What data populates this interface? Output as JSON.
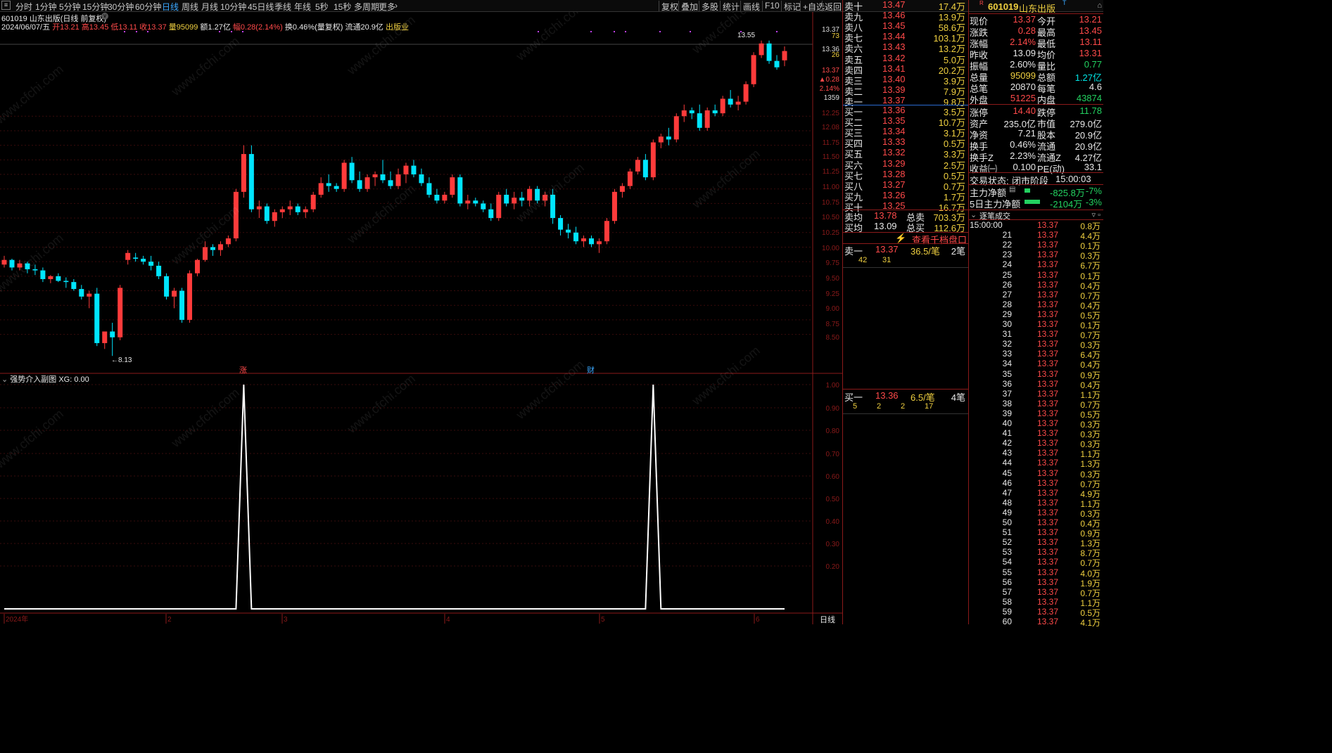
{
  "toolbar": {
    "periods": [
      "分时",
      "1分钟",
      "5分钟",
      "15分钟",
      "30分钟",
      "60分钟",
      "日线",
      "周线",
      "月线",
      "10分钟",
      "45日线",
      "季线",
      "年线",
      "5秒",
      "15秒",
      "多周期",
      "更多"
    ],
    "active_period": "日线",
    "right_buttons": [
      "复权",
      "叠加",
      "多股",
      "统计",
      "画线",
      "F10",
      "标记",
      "+自选",
      "返回"
    ]
  },
  "main_chart": {
    "title": "601019 山东出版(日线 前复权)",
    "date": "2024/06/07/五",
    "open": "开13.21",
    "high": "高13.45",
    "low": "低13.11",
    "close": "收13.37",
    "volume": "量95099",
    "amount": "额1.27亿",
    "change": "幅0.28(2.14%)",
    "turnover": "换0.46%(量复权)",
    "float": "流通20.9亿",
    "sector": "出版业",
    "high_label": "13.55",
    "low_label": "8.13",
    "marker_zhang": "涨",
    "marker_cai": "财",
    "price_axis": [
      "13.37",
      "13.36",
      "12.25",
      "12.08",
      "11.75",
      "11.50",
      "11.25",
      "11.00",
      "10.75",
      "10.50",
      "10.25",
      "10.00",
      "9.75",
      "9.50",
      "9.25",
      "9.00",
      "8.75",
      "8.50"
    ],
    "price_axis_side": [
      "73",
      "26",
      "13.37",
      "▲0.28",
      "2.14%",
      "1359"
    ],
    "candles_ohlc_note": "daily candles Jan–Jun 2024",
    "candles": [
      [
        9.7,
        9.85,
        9.65,
        9.78
      ],
      [
        9.78,
        9.8,
        9.6,
        9.65
      ],
      [
        9.65,
        9.78,
        9.6,
        9.72
      ],
      [
        9.72,
        9.75,
        9.55,
        9.62
      ],
      [
        9.62,
        9.7,
        9.52,
        9.6
      ],
      [
        9.6,
        9.65,
        9.4,
        9.45
      ],
      [
        9.45,
        9.52,
        9.38,
        9.5
      ],
      [
        9.5,
        9.55,
        9.4,
        9.42
      ],
      [
        9.42,
        9.48,
        9.3,
        9.4
      ],
      [
        9.4,
        9.45,
        9.25,
        9.28
      ],
      [
        9.28,
        9.35,
        9.1,
        9.15
      ],
      [
        9.15,
        9.25,
        8.95,
        9.2
      ],
      [
        9.2,
        9.3,
        8.3,
        8.35
      ],
      [
        8.35,
        8.55,
        8.25,
        8.55
      ],
      [
        8.55,
        8.7,
        8.13,
        8.45
      ],
      [
        8.45,
        9.35,
        8.4,
        9.3
      ],
      [
        9.78,
        9.95,
        9.7,
        9.9
      ],
      [
        9.82,
        9.9,
        9.75,
        9.8
      ],
      [
        9.8,
        9.85,
        9.7,
        9.75
      ],
      [
        9.75,
        9.85,
        9.6,
        9.68
      ],
      [
        9.68,
        9.75,
        9.45,
        9.5
      ],
      [
        9.5,
        9.55,
        9.1,
        9.15
      ],
      [
        9.15,
        9.3,
        8.95,
        9.25
      ],
      [
        9.25,
        9.3,
        8.7,
        8.75
      ],
      [
        8.75,
        9.6,
        8.7,
        9.55
      ],
      [
        9.55,
        9.8,
        9.5,
        9.78
      ],
      [
        9.78,
        10.1,
        9.75,
        10.0
      ],
      [
        10.0,
        10.05,
        9.85,
        9.95
      ],
      [
        9.95,
        10.1,
        9.85,
        10.05
      ],
      [
        10.05,
        10.2,
        10.0,
        10.15
      ],
      [
        10.15,
        11.0,
        10.1,
        10.95
      ],
      [
        10.95,
        11.75,
        10.85,
        11.6
      ],
      [
        11.6,
        11.75,
        10.6,
        10.65
      ],
      [
        10.65,
        10.8,
        10.5,
        10.7
      ],
      [
        10.7,
        10.75,
        10.4,
        10.45
      ],
      [
        10.45,
        10.65,
        10.35,
        10.6
      ],
      [
        10.6,
        10.7,
        10.5,
        10.65
      ],
      [
        10.65,
        10.8,
        10.55,
        10.7
      ],
      [
        10.7,
        10.75,
        10.55,
        10.6
      ],
      [
        10.6,
        10.7,
        10.5,
        10.65
      ],
      [
        10.65,
        10.95,
        10.6,
        10.9
      ],
      [
        10.9,
        11.2,
        10.85,
        11.1
      ],
      [
        11.1,
        11.25,
        10.95,
        11.05
      ],
      [
        11.05,
        11.1,
        10.95,
        11.0
      ],
      [
        11.0,
        11.5,
        10.95,
        11.45
      ],
      [
        11.45,
        11.55,
        11.1,
        11.15
      ],
      [
        11.15,
        11.3,
        10.95,
        11.0
      ],
      [
        11.0,
        11.25,
        10.95,
        11.2
      ],
      [
        11.2,
        11.3,
        11.05,
        11.25
      ],
      [
        11.25,
        11.5,
        11.1,
        11.15
      ],
      [
        11.15,
        11.3,
        11.0,
        11.05
      ],
      [
        11.05,
        11.35,
        11.0,
        11.25
      ],
      [
        11.25,
        11.45,
        11.1,
        11.4
      ],
      [
        11.4,
        11.5,
        11.2,
        11.25
      ],
      [
        11.25,
        11.35,
        11.05,
        11.1
      ],
      [
        11.1,
        11.2,
        10.85,
        10.9
      ],
      [
        10.9,
        11.0,
        10.75,
        10.8
      ],
      [
        10.8,
        10.95,
        10.75,
        10.9
      ],
      [
        10.9,
        11.25,
        10.85,
        11.2
      ],
      [
        11.2,
        11.25,
        10.7,
        10.75
      ],
      [
        10.75,
        10.9,
        10.65,
        10.8
      ],
      [
        10.8,
        10.85,
        10.7,
        10.75
      ],
      [
        10.75,
        10.8,
        10.6,
        10.65
      ],
      [
        10.65,
        10.75,
        10.45,
        10.5
      ],
      [
        10.5,
        10.95,
        10.45,
        10.9
      ],
      [
        10.9,
        11.0,
        10.7,
        10.75
      ],
      [
        10.75,
        10.95,
        10.65,
        10.85
      ],
      [
        10.85,
        10.95,
        10.7,
        10.8
      ],
      [
        10.8,
        11.05,
        10.7,
        11.0
      ],
      [
        11.0,
        11.05,
        10.75,
        10.8
      ],
      [
        10.8,
        10.95,
        10.7,
        10.9
      ],
      [
        10.9,
        11.0,
        10.4,
        10.5
      ],
      [
        10.5,
        10.55,
        10.2,
        10.3
      ],
      [
        10.3,
        10.4,
        10.15,
        10.25
      ],
      [
        10.25,
        10.35,
        10.05,
        10.1
      ],
      [
        10.1,
        10.2,
        10.0,
        10.15
      ],
      [
        10.15,
        10.2,
        10.0,
        10.05
      ],
      [
        10.05,
        10.15,
        9.9,
        10.1
      ],
      [
        10.1,
        10.5,
        10.05,
        10.45
      ],
      [
        10.45,
        11.0,
        10.4,
        10.95
      ],
      [
        10.95,
        11.1,
        10.85,
        11.05
      ],
      [
        11.05,
        11.35,
        11.0,
        11.3
      ],
      [
        11.3,
        11.55,
        11.25,
        11.5
      ],
      [
        11.5,
        11.6,
        11.15,
        11.2
      ],
      [
        11.2,
        11.85,
        11.15,
        11.8
      ],
      [
        11.8,
        11.95,
        11.7,
        11.9
      ],
      [
        11.9,
        12.05,
        11.75,
        11.85
      ],
      [
        11.85,
        12.3,
        11.8,
        12.25
      ],
      [
        12.25,
        12.45,
        12.15,
        12.35
      ],
      [
        12.35,
        12.4,
        12.2,
        12.3
      ],
      [
        12.3,
        12.45,
        12.0,
        12.05
      ],
      [
        12.05,
        12.4,
        12.0,
        12.35
      ],
      [
        12.35,
        12.45,
        12.25,
        12.3
      ],
      [
        12.3,
        12.6,
        12.25,
        12.55
      ],
      [
        12.55,
        12.7,
        12.4,
        12.45
      ],
      [
        12.45,
        12.6,
        12.35,
        12.5
      ],
      [
        12.5,
        12.85,
        12.45,
        12.8
      ],
      [
        12.8,
        13.35,
        12.75,
        13.3
      ],
      [
        13.3,
        13.55,
        13.25,
        13.5
      ],
      [
        13.5,
        13.55,
        13.15,
        13.2
      ],
      [
        13.2,
        13.3,
        13.05,
        13.09
      ],
      [
        13.21,
        13.45,
        13.11,
        13.37
      ]
    ],
    "x_axis": [
      "2024年",
      "2",
      "3",
      "4",
      "5",
      "6"
    ],
    "period_label": "日线"
  },
  "sub_chart": {
    "title": "强势介入副图",
    "value": "XG: 0.00",
    "y_axis": [
      "1.00",
      "0.90",
      "0.80",
      "0.70",
      "0.60",
      "0.50",
      "0.40",
      "0.30",
      "0.20"
    ],
    "signals": [
      0,
      0,
      0,
      0,
      0,
      0,
      0,
      0,
      0,
      0,
      0,
      0,
      0,
      0,
      0,
      0,
      0,
      0,
      0,
      0,
      0,
      0,
      0,
      0,
      0,
      0,
      0,
      0,
      0,
      0,
      0,
      1,
      0,
      0,
      0,
      0,
      0,
      0,
      0,
      0,
      0,
      0,
      0,
      0,
      0,
      0,
      0,
      0,
      0,
      0,
      0,
      0,
      0,
      0,
      0,
      0,
      0,
      0,
      0,
      0,
      0,
      0,
      0,
      0,
      0,
      0,
      0,
      0,
      0,
      0,
      0,
      0,
      0,
      0,
      0,
      0,
      0,
      0,
      0,
      0,
      0,
      0,
      0,
      0,
      1,
      0,
      0,
      0,
      0,
      0,
      0,
      0,
      0,
      0,
      0,
      0,
      0,
      0,
      0,
      0,
      0,
      0
    ]
  },
  "orderbook": {
    "asks": [
      {
        "label": "卖十",
        "price": "13.47",
        "vol": "17.4万"
      },
      {
        "label": "卖九",
        "price": "13.46",
        "vol": "13.9万"
      },
      {
        "label": "卖八",
        "price": "13.45",
        "vol": "58.6万"
      },
      {
        "label": "卖七",
        "price": "13.44",
        "vol": "103.1万"
      },
      {
        "label": "卖六",
        "price": "13.43",
        "vol": "13.2万"
      },
      {
        "label": "卖五",
        "price": "13.42",
        "vol": "5.0万"
      },
      {
        "label": "卖四",
        "price": "13.41",
        "vol": "20.2万"
      },
      {
        "label": "卖三",
        "price": "13.40",
        "vol": "3.9万"
      },
      {
        "label": "卖二",
        "price": "13.39",
        "vol": "7.9万"
      },
      {
        "label": "卖一",
        "price": "13.37",
        "vol": "9.8万"
      }
    ],
    "bids": [
      {
        "label": "买一",
        "price": "13.36",
        "vol": "3.5万"
      },
      {
        "label": "买二",
        "price": "13.35",
        "vol": "10.7万"
      },
      {
        "label": "买三",
        "price": "13.34",
        "vol": "3.1万"
      },
      {
        "label": "买四",
        "price": "13.33",
        "vol": "0.5万"
      },
      {
        "label": "买五",
        "price": "13.32",
        "vol": "3.3万"
      },
      {
        "label": "买六",
        "price": "13.29",
        "vol": "2.5万"
      },
      {
        "label": "买七",
        "price": "13.28",
        "vol": "0.5万"
      },
      {
        "label": "买八",
        "price": "13.27",
        "vol": "0.7万"
      },
      {
        "label": "买九",
        "price": "13.26",
        "vol": "1.7万"
      },
      {
        "label": "买十",
        "price": "13.25",
        "vol": "16.7万"
      }
    ],
    "avg_ask_label": "卖均",
    "avg_ask": "13.78",
    "total_sell_label": "总卖",
    "total_sell": "703.3万",
    "avg_bid_label": "买均",
    "avg_bid": "13.09",
    "total_buy_label": "总买",
    "total_buy": "112.6万",
    "depth_link": "查看千档盘口",
    "sell1_label": "卖一",
    "sell1_price": "13.37",
    "sell1_per": "36.5/笔",
    "sell1_count": "2笔",
    "sell1_queue": [
      "42",
      "31"
    ],
    "buy1_label": "买一",
    "buy1_price": "13.36",
    "buy1_per": "6.5/笔",
    "buy1_count": "4笔",
    "buy1_queue": [
      "5",
      "2",
      "2",
      "17"
    ]
  },
  "quote": {
    "code": "601019",
    "name": "山东出版",
    "badge": "R",
    "rows": [
      [
        "现价",
        "13.37",
        "今开",
        "13.21"
      ],
      [
        "涨跌",
        "0.28",
        "最高",
        "13.45"
      ],
      [
        "涨幅",
        "2.14%",
        "最低",
        "13.11"
      ],
      [
        "昨收",
        "13.09",
        "均价",
        "13.31"
      ],
      [
        "振幅",
        "2.60%",
        "量比",
        "0.77"
      ],
      [
        "总量",
        "95099",
        "总额",
        "1.27亿"
      ],
      [
        "总笔",
        "20870",
        "每笔",
        "4.6"
      ],
      [
        "外盘",
        "51225",
        "内盘",
        "43874"
      ],
      [
        "涨停",
        "14.40",
        "跌停",
        "11.78"
      ],
      [
        "资产",
        "235.0亿",
        "市值",
        "279.0亿"
      ],
      [
        "净资",
        "7.21",
        "股本",
        "20.9亿"
      ],
      [
        "换手",
        "0.46%",
        "流通",
        "20.9亿"
      ],
      [
        "换手Z",
        "2.23%",
        "流通Z",
        "4.27亿"
      ],
      [
        "收益㈠",
        "0.100",
        "PE(动)",
        "33.1"
      ]
    ],
    "status_label": "交易状态:",
    "status": "闭市阶段",
    "status_time": "15:00:03",
    "main_flow_label": "主力净额",
    "main_flow": "-825.8万",
    "main_flow_pct": "-7%",
    "main_flow5_label": "5日主力净额",
    "main_flow5": "-2104万",
    "main_flow5_pct": "-3%"
  },
  "trades": {
    "title": "逐笔成交",
    "rows": [
      [
        "15:00:00",
        "13.37",
        "0.8万"
      ],
      [
        "21",
        "13.37",
        "4.4万"
      ],
      [
        "22",
        "13.37",
        "0.1万"
      ],
      [
        "23",
        "13.37",
        "0.3万"
      ],
      [
        "24",
        "13.37",
        "6.7万"
      ],
      [
        "25",
        "13.37",
        "0.1万"
      ],
      [
        "26",
        "13.37",
        "0.4万"
      ],
      [
        "27",
        "13.37",
        "0.7万"
      ],
      [
        "28",
        "13.37",
        "0.4万"
      ],
      [
        "29",
        "13.37",
        "0.5万"
      ],
      [
        "30",
        "13.37",
        "0.1万"
      ],
      [
        "31",
        "13.37",
        "0.7万"
      ],
      [
        "32",
        "13.37",
        "0.3万"
      ],
      [
        "33",
        "13.37",
        "6.4万"
      ],
      [
        "34",
        "13.37",
        "0.4万"
      ],
      [
        "35",
        "13.37",
        "0.9万"
      ],
      [
        "36",
        "13.37",
        "0.4万"
      ],
      [
        "37",
        "13.37",
        "1.1万"
      ],
      [
        "38",
        "13.37",
        "0.7万"
      ],
      [
        "39",
        "13.37",
        "0.5万"
      ],
      [
        "40",
        "13.37",
        "0.3万"
      ],
      [
        "41",
        "13.37",
        "0.3万"
      ],
      [
        "42",
        "13.37",
        "0.3万"
      ],
      [
        "43",
        "13.37",
        "1.1万"
      ],
      [
        "44",
        "13.37",
        "1.3万"
      ],
      [
        "45",
        "13.37",
        "0.3万"
      ],
      [
        "46",
        "13.37",
        "0.7万"
      ],
      [
        "47",
        "13.37",
        "4.9万"
      ],
      [
        "48",
        "13.37",
        "1.1万"
      ],
      [
        "49",
        "13.37",
        "0.3万"
      ],
      [
        "50",
        "13.37",
        "0.4万"
      ],
      [
        "51",
        "13.37",
        "0.9万"
      ],
      [
        "52",
        "13.37",
        "1.3万"
      ],
      [
        "53",
        "13.37",
        "8.7万"
      ],
      [
        "54",
        "13.37",
        "0.7万"
      ],
      [
        "55",
        "13.37",
        "4.0万"
      ],
      [
        "56",
        "13.37",
        "1.9万"
      ],
      [
        "57",
        "13.37",
        "0.7万"
      ],
      [
        "58",
        "13.37",
        "1.1万"
      ],
      [
        "59",
        "13.37",
        "0.5万"
      ],
      [
        "60",
        "13.37",
        "4.1万"
      ]
    ]
  },
  "watermark": "www.cfchi.com"
}
